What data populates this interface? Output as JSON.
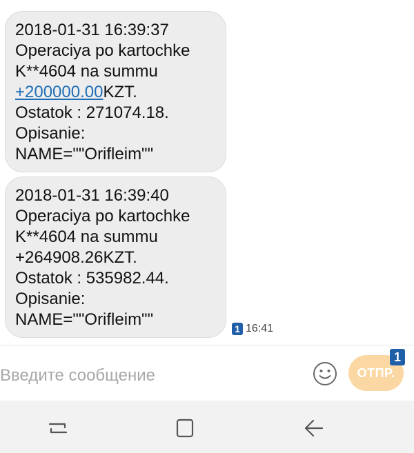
{
  "messages": [
    {
      "lines": [
        "2018-01-31 16:39:37",
        "Operaciya po kartochke",
        "K**4604 na summu"
      ],
      "amount_link": "+200000.00",
      "amount_suffix": "KZT.",
      "tail_lines": [
        "Ostatok : 271074.18.",
        "Opisanie:",
        "NAME=\"\"Orifleim\"\""
      ]
    },
    {
      "lines": [
        "2018-01-31 16:39:40",
        "Operaciya po kartochke",
        "K**4604 na summu",
        "+264908.26KZT.",
        "Ostatok : 535982.44.",
        "Opisanie:",
        "NAME=\"\"Orifleim\"\""
      ],
      "sim_badge": "1",
      "time": "16:41"
    }
  ],
  "composer": {
    "placeholder": "Введите сообщение",
    "emoji_icon": "smiley-icon",
    "send_label": "ОТПР.",
    "send_badge": "1"
  },
  "navbar": {
    "icons": [
      "recent-apps-icon",
      "home-icon",
      "back-icon"
    ]
  },
  "colors": {
    "bubble": "#ededed",
    "link": "#1f6fb8",
    "send_button": "#fbd8a3",
    "badge": "#1f5fa8",
    "placeholder": "#a8a8a8"
  }
}
